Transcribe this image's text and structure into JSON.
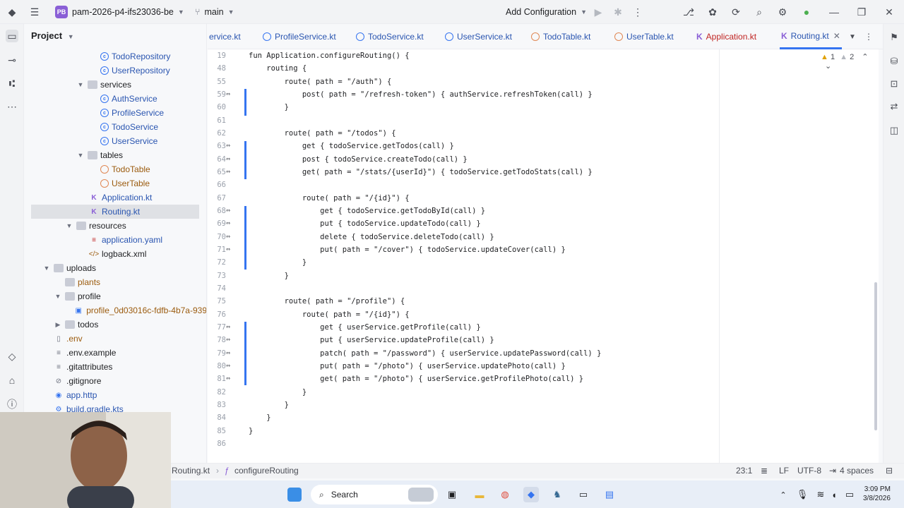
{
  "titlebar": {
    "project_badge": "PB",
    "project_name": "pam-2026-p4-ifs23036-be",
    "branch": "main",
    "run_config": "Add Configuration"
  },
  "project_panel": {
    "title": "Project",
    "tree": [
      {
        "label": "TodoRepository",
        "kind": "class"
      },
      {
        "label": "UserRepository",
        "kind": "class"
      },
      {
        "label": "services",
        "kind": "folder"
      },
      {
        "label": "AuthService",
        "kind": "class"
      },
      {
        "label": "ProfileService",
        "kind": "class"
      },
      {
        "label": "TodoService",
        "kind": "class"
      },
      {
        "label": "UserService",
        "kind": "class"
      },
      {
        "label": "tables",
        "kind": "folder"
      },
      {
        "label": "TodoTable",
        "kind": "object"
      },
      {
        "label": "UserTable",
        "kind": "object"
      },
      {
        "label": "Application.kt",
        "kind": "file"
      },
      {
        "label": "Routing.kt",
        "kind": "file"
      },
      {
        "label": "resources",
        "kind": "folder"
      },
      {
        "label": "application.yaml",
        "kind": "file"
      },
      {
        "label": "logback.xml",
        "kind": "file"
      },
      {
        "label": "uploads",
        "kind": "folder"
      },
      {
        "label": "plants",
        "kind": "folder"
      },
      {
        "label": "profile",
        "kind": "folder"
      },
      {
        "label": "profile_0d03016c-fdfb-4b7a-939",
        "kind": "file"
      },
      {
        "label": "todos",
        "kind": "folder"
      },
      {
        "label": ".env",
        "kind": "file"
      },
      {
        "label": ".env.example",
        "kind": "file"
      },
      {
        "label": ".gitattributes",
        "kind": "file"
      },
      {
        "label": ".gitignore",
        "kind": "file"
      },
      {
        "label": "app.http",
        "kind": "file"
      },
      {
        "label": "build.gradle.kts",
        "kind": "file"
      }
    ]
  },
  "tabs": [
    "ervice.kt",
    "ProfileService.kt",
    "TodoService.kt",
    "UserService.kt",
    "TodoTable.kt",
    "UserTable.kt",
    "Application.kt",
    "Routing.kt"
  ],
  "editor": {
    "inspections": {
      "warnings": "1",
      "weak_warnings": "2"
    },
    "line_numbers": [
      "19",
      "48",
      "55",
      "59",
      "60",
      "61",
      "62",
      "63",
      "64",
      "65",
      "66",
      "67",
      "68",
      "69",
      "70",
      "71",
      "72",
      "73",
      "74",
      "75",
      "76",
      "77",
      "78",
      "79",
      "80",
      "81",
      "82",
      "83",
      "84",
      "85",
      "86"
    ],
    "lines": [
      "fun Application.configureRouting() {",
      "    routing {",
      "        route( path = \"/auth\") {",
      "            post( path = \"/refresh-token\") { authService.refreshToken(call) }",
      "        }",
      "",
      "        route( path = \"/todos\") {",
      "            get { todoService.getTodos(call) }",
      "            post { todoService.createTodo(call) }",
      "            get( path = \"/stats/{userId}\") { todoService.getTodoStats(call) }",
      "",
      "            route( path = \"/{id}\") {",
      "                get { todoService.getTodoById(call) }",
      "                put { todoService.updateTodo(call) }",
      "                delete { todoService.deleteTodo(call) }",
      "                put( path = \"/cover\") { todoService.updateCover(call) }",
      "            }",
      "        }",
      "",
      "        route( path = \"/profile\") {",
      "            route( path = \"/{id}\") {",
      "                get { userService.getProfile(call) }",
      "                put { userService.updateProfile(call) }",
      "                patch( path = \"/password\") { userService.updatePassword(call) }",
      "                put( path = \"/photo\") { userService.updatePhoto(call) }",
      "                get( path = \"/photo\") { userService.getProfilePhoto(call) }",
      "            }",
      "        }",
      "    }",
      "}",
      ""
    ]
  },
  "statusbar": {
    "breadcrumb_file": "Routing.kt",
    "breadcrumb_symbol": "configureRouting",
    "position": "23:1",
    "line_ending": "LF",
    "encoding": "UTF-8",
    "indent": "4 spaces"
  },
  "taskbar": {
    "search_placeholder": "Search",
    "time": "3:09 PM",
    "date": "3/8/2026"
  },
  "colors": {
    "accent": "#3574f0",
    "keyword": "#0033b3",
    "string": "#067d17"
  }
}
